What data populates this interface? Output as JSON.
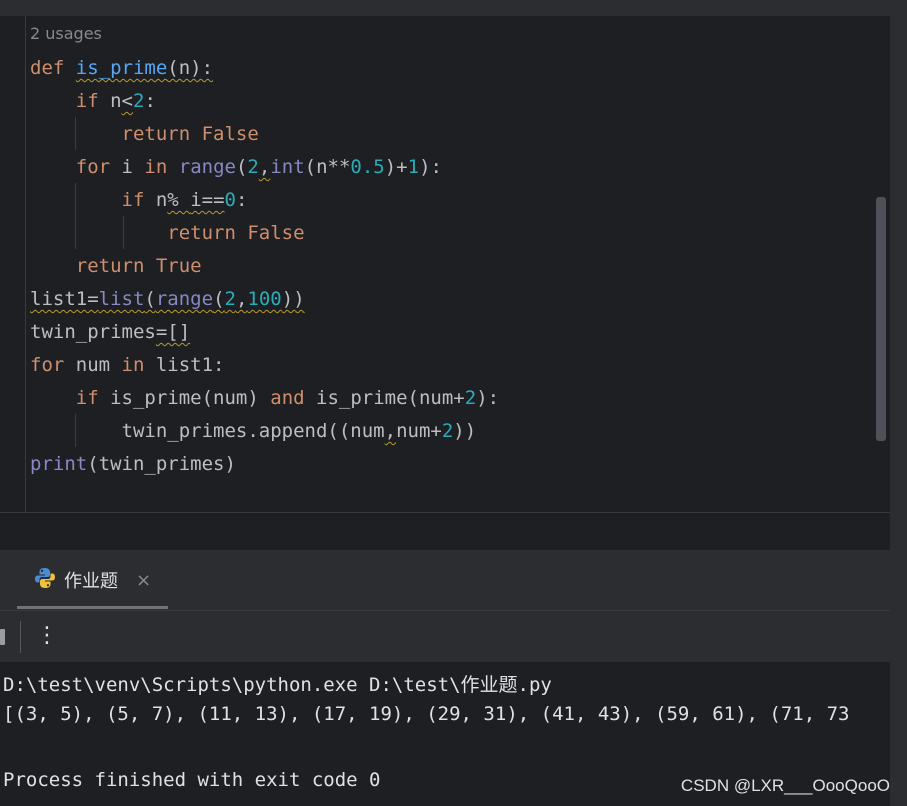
{
  "editor": {
    "usages": "2 usages",
    "lines": {
      "l1": {
        "def": "def ",
        "name": "is_prime",
        "rest": "(n):"
      },
      "l2": {
        "kw": "if ",
        "a": "n",
        "b": "<",
        "num": "2",
        "c": ":"
      },
      "l3": {
        "kw": "return False"
      },
      "l4": {
        "kw1": "for ",
        "a": "i ",
        "kw2": "in ",
        "bi1": "range",
        "b": "(",
        "n1": "2",
        "comma": ",",
        "bi2": "int",
        "c": "(n**",
        "n2": "0.5",
        "d": ")+",
        "n3": "1",
        "e": "):"
      },
      "l5": {
        "kw": "if ",
        "a": "n",
        "b": "% ",
        "c": "i==",
        "num": "0",
        "d": ":"
      },
      "l6": {
        "kw": "return False"
      },
      "l7": {
        "kw": "return True"
      },
      "l8": {
        "a": "list1=",
        "bi1": "list",
        "b": "(",
        "bi2": "range",
        "c": "(",
        "n1": "2",
        "d": ",",
        "n2": "100",
        "e": "))"
      },
      "l9": {
        "a": "twin_primes",
        "b": "=[]"
      },
      "l10": {
        "kw1": "for ",
        "a": "num ",
        "kw2": "in ",
        "b": "list1:"
      },
      "l11": {
        "kw1": "if ",
        "a": "is_prime(num) ",
        "kw2": "and ",
        "b": "is_prime(num+",
        "num": "2",
        "c": "):"
      },
      "l12": {
        "a": "twin_primes.append((num",
        "comma": ",",
        "b": "num+",
        "num": "2",
        "c": "))"
      },
      "l13": {
        "bi": "print",
        "a": "(twin_primes)"
      }
    }
  },
  "run_panel": {
    "tab_label": "作业题",
    "tab_close": "×",
    "more_icon": "⋮",
    "console": {
      "line1": "D:\\test\\venv\\Scripts\\python.exe D:\\test\\作业题.py",
      "line2": "[(3, 5), (5, 7), (11, 13), (17, 19), (29, 31), (41, 43), (59, 61), (71, 73",
      "line3": "",
      "line4": "Process finished with exit code 0"
    }
  },
  "watermark": "CSDN @LXR___OooQooO"
}
